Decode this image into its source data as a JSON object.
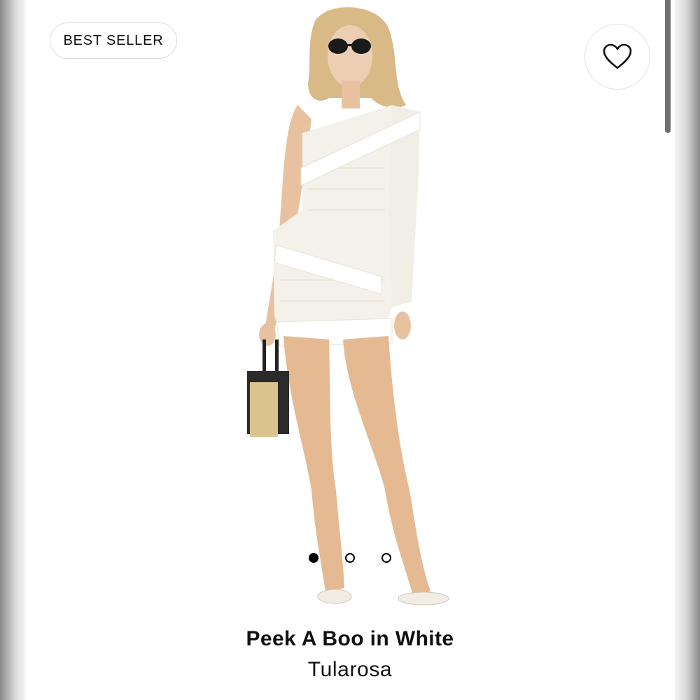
{
  "badge": {
    "label": "BEST SELLER"
  },
  "favorite": {
    "icon": "heart-outline-icon"
  },
  "product": {
    "title": "Peek A Boo in White",
    "brand": "Tularosa"
  },
  "carousel": {
    "total": 3,
    "active_index": 0
  },
  "colors": {
    "text": "#111111",
    "dot": "#000000",
    "border": "#dcdcdc"
  }
}
